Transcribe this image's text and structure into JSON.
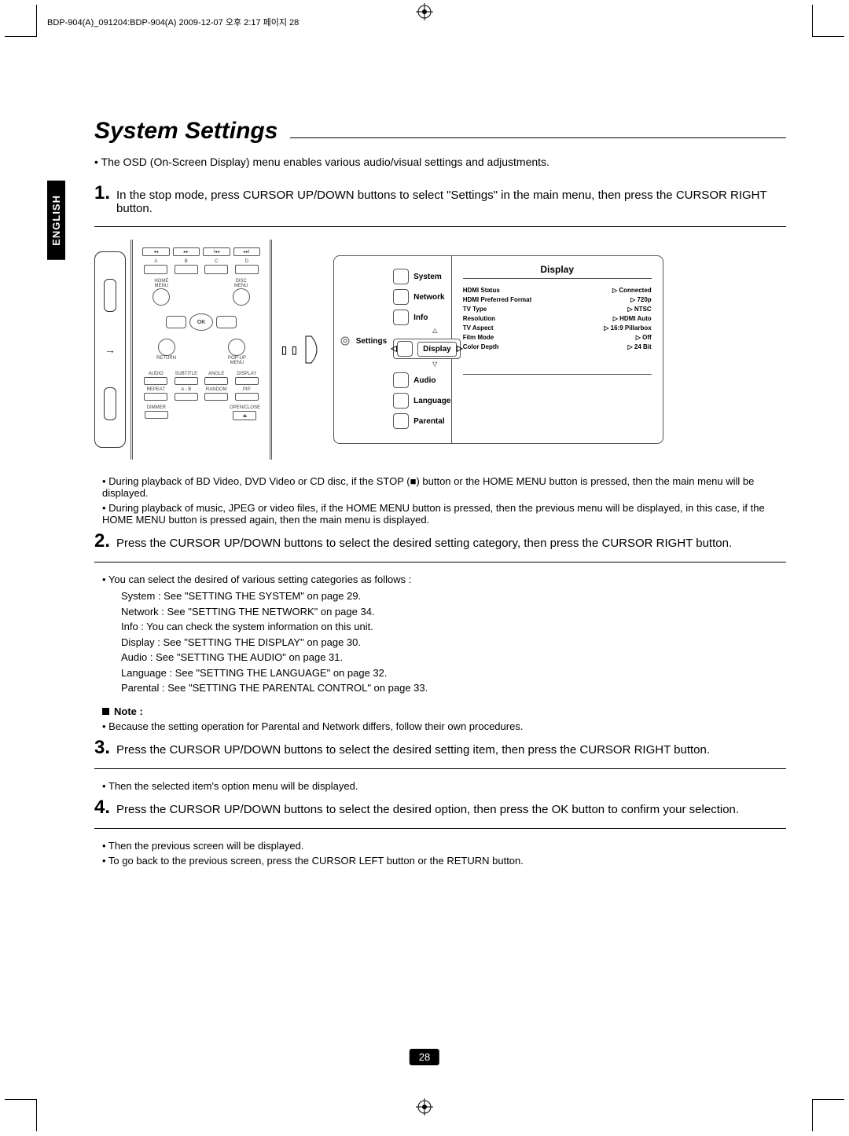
{
  "header_text": "BDP-904(A)_091204:BDP-904(A)  2009-12-07  오후 2:17  페이지 28",
  "lang_tab": "ENGLISH",
  "title": "System Settings",
  "intro": "• The OSD (On-Screen Display) menu enables various audio/visual settings and adjustments.",
  "steps": [
    {
      "num": "1.",
      "text": "In the stop mode, press CURSOR UP/DOWN buttons to select \"Settings\" in the main menu, then press the CURSOR RIGHT button."
    },
    {
      "num": "2.",
      "text": "Press the CURSOR UP/DOWN buttons to select the desired setting category, then press the CURSOR RIGHT button."
    },
    {
      "num": "3.",
      "text": "Press the CURSOR UP/DOWN buttons to select the desired setting item, then press the CURSOR RIGHT button."
    },
    {
      "num": "4.",
      "text": "Press the CURSOR UP/DOWN buttons to select the desired option, then press the OK button to confirm your selection."
    }
  ],
  "step1_notes": [
    "• During playback of BD Video, DVD Video or CD disc, if the STOP (■) button or the HOME MENU button is pressed, then the main menu will be displayed.",
    "• During playback of music, JPEG or video files, if the HOME MENU button is pressed, then the previous menu will be displayed, in this case, if the HOME MENU button is pressed again, then the main menu is displayed."
  ],
  "step2_cat_intro": "• You can  select the desired of various setting categories as follows :",
  "step2_categories": [
    "System : See \"SETTING THE SYSTEM\" on page 29.",
    "Network : See \"SETTING THE NETWORK\" on page 34.",
    "Info : You can check the system information on this unit.",
    "Display : See \"SETTING THE DISPLAY\" on page 30.",
    "Audio : See \"SETTING THE AUDIO\" on page 31.",
    "Language : See \"SETTING THE LANGUAGE\" on page 32.",
    "Parental : See \"SETTING THE PARENTAL CONTROL\" on page 33."
  ],
  "note_head": "Note :",
  "step2_note": "• Because the setting operation for Parental and Network differs, follow their own procedures.",
  "step3_note": "• Then the selected item's option menu will be displayed.",
  "step4_notes": [
    "• Then the previous screen will be displayed.",
    "• To go back to the previous screen, press the CURSOR LEFT button or the RETURN button."
  ],
  "page_num": "28",
  "remote": {
    "top_row": [
      "A",
      "B",
      "C",
      "D"
    ],
    "home_menu": "HOME\nMENU",
    "disc_menu": "DISC\nMENU",
    "ok": "OK",
    "return": "RETURN",
    "popup": "POP-UP\nMENU",
    "row1": [
      "AUDIO",
      "SUBTITLE",
      "ANGLE",
      "DISPLAY"
    ],
    "row2": [
      "REPEAT",
      "A - B",
      "RANDOM",
      "PIP"
    ],
    "dimmer": "DIMMER",
    "open_close": "OPEN/CLOSE"
  },
  "osd": {
    "settings_label": "Settings",
    "menu": [
      "System",
      "Network",
      "Info",
      "Display",
      "Audio",
      "Language",
      "Parental"
    ],
    "panel_title": "Display",
    "panel_rows": [
      {
        "k": "HDMI Status",
        "v": "Connected"
      },
      {
        "k": "HDMI Preferred Format",
        "v": "720p"
      },
      {
        "k": "TV Type",
        "v": "NTSC"
      },
      {
        "k": "Resolution",
        "v": "HDMI Auto"
      },
      {
        "k": "TV Aspect",
        "v": "16:9 Pillarbox"
      },
      {
        "k": "Film Mode",
        "v": "Off"
      },
      {
        "k": "Color Depth",
        "v": "24 Bit"
      }
    ]
  }
}
